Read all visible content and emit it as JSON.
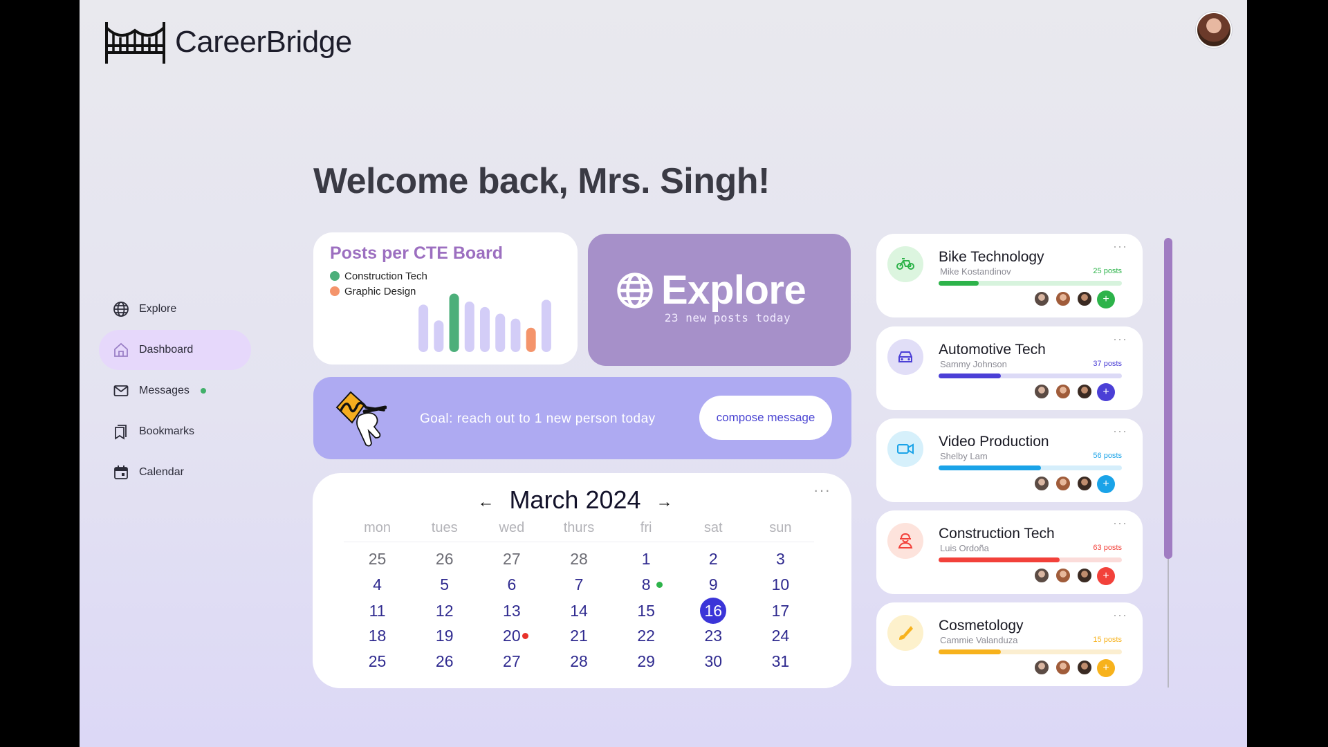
{
  "brand": {
    "name": "CareerBridge"
  },
  "header": {
    "avatar": "user-avatar"
  },
  "welcome": "Welcome back, Mrs. Singh!",
  "nav": {
    "items": [
      {
        "label": "Explore",
        "icon": "globe-icon"
      },
      {
        "label": "Dashboard",
        "icon": "home-icon",
        "active": true
      },
      {
        "label": "Messages",
        "icon": "mail-icon",
        "has_new": true
      },
      {
        "label": "Bookmarks",
        "icon": "bookmark-icon"
      },
      {
        "label": "Calendar",
        "icon": "calendar-icon"
      }
    ]
  },
  "chart": {
    "title": "Posts per CTE Board",
    "legend": [
      {
        "label": "Construction Tech",
        "color": "#4caf7a"
      },
      {
        "label": "Graphic Design",
        "color": "#f4946b"
      }
    ]
  },
  "chart_data": {
    "type": "bar",
    "title": "Posts per CTE Board",
    "series": [
      {
        "name": "Construction Tech",
        "color": "#4caf7a"
      },
      {
        "name": "Graphic Design",
        "color": "#f4946b"
      }
    ],
    "values": [
      78,
      52,
      96,
      83,
      74,
      63,
      55,
      40,
      86
    ],
    "bar_colors": [
      "#d3cdf7",
      "#d3cdf7",
      "#4caf7a",
      "#d3cdf7",
      "#d3cdf7",
      "#d3cdf7",
      "#d3cdf7",
      "#f4946b",
      "#d3cdf7"
    ],
    "ylim": [
      0,
      100
    ],
    "grid": false,
    "legend_position": "top-left"
  },
  "explore": {
    "title": "Explore",
    "subtitle": "23 new posts today",
    "icon": "globe-icon"
  },
  "goal": {
    "text": "Goal: reach out to 1 new person today",
    "button": "compose message",
    "icon": "signature-icon"
  },
  "calendar": {
    "month": "March 2024",
    "prev": "←",
    "next": "→",
    "more": "···",
    "weekdays": [
      "mon",
      "tues",
      "wed",
      "thurs",
      "fri",
      "sat",
      "sun"
    ],
    "weeks": [
      [
        {
          "d": "25",
          "m": true
        },
        {
          "d": "26",
          "m": true
        },
        {
          "d": "27",
          "m": true
        },
        {
          "d": "28",
          "m": true
        },
        {
          "d": "1"
        },
        {
          "d": "2"
        },
        {
          "d": "3"
        }
      ],
      [
        {
          "d": "4"
        },
        {
          "d": "5"
        },
        {
          "d": "6"
        },
        {
          "d": "7"
        },
        {
          "d": "8",
          "dot": "#2db34a"
        },
        {
          "d": "9"
        },
        {
          "d": "10"
        }
      ],
      [
        {
          "d": "11"
        },
        {
          "d": "12"
        },
        {
          "d": "13"
        },
        {
          "d": "14"
        },
        {
          "d": "15"
        },
        {
          "d": "16",
          "today": true
        },
        {
          "d": "17"
        }
      ],
      [
        {
          "d": "18"
        },
        {
          "d": "19"
        },
        {
          "d": "20",
          "dot": "#e8322a"
        },
        {
          "d": "21"
        },
        {
          "d": "22"
        },
        {
          "d": "23"
        },
        {
          "d": "24"
        }
      ],
      [
        {
          "d": "25"
        },
        {
          "d": "26"
        },
        {
          "d": "27"
        },
        {
          "d": "28"
        },
        {
          "d": "29"
        },
        {
          "d": "30"
        },
        {
          "d": "31"
        }
      ]
    ]
  },
  "boards": [
    {
      "name": "Bike Technology",
      "owner": "Mike Kostandinov",
      "posts": "25 posts",
      "progress": 0.22,
      "color": "#2db34a",
      "track": "#d7f3dd",
      "icon_bg": "#dcf5df",
      "icon": "bike-icon"
    },
    {
      "name": "Automotive Tech",
      "owner": "Sammy Johnson",
      "posts": "37 posts",
      "progress": 0.34,
      "color": "#4b3fd6",
      "track": "#dcdaf6",
      "icon_bg": "#e1def7",
      "icon": "car-icon"
    },
    {
      "name": "Video Production",
      "owner": "Shelby Lam",
      "posts": "56 posts",
      "progress": 0.56,
      "color": "#1aa3e8",
      "track": "#d5eefb",
      "icon_bg": "#d6f0fb",
      "icon": "video-camera-icon"
    },
    {
      "name": "Construction Tech",
      "owner": "Luis Ordoña",
      "posts": "63 posts",
      "progress": 0.66,
      "color": "#f2413a",
      "track": "#fbdcda",
      "icon_bg": "#fde3dc",
      "icon": "worker-icon"
    },
    {
      "name": "Cosmetology",
      "owner": "Cammie Valanduza",
      "posts": "15 posts",
      "progress": 0.34,
      "color": "#f7b21c",
      "track": "#fbeed0",
      "icon_bg": "#fdf1cc",
      "icon": "brush-icon"
    }
  ],
  "board_more": "···",
  "add_label": "+"
}
